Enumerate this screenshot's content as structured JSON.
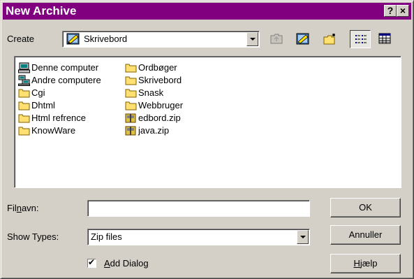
{
  "window": {
    "title": "New Archive",
    "help_glyph": "?",
    "close_glyph": "×"
  },
  "create": {
    "label": "Create",
    "location": "Skrivebord"
  },
  "toolbar": {
    "buttons": [
      "up-folder-icon",
      "desktop-icon",
      "new-folder-icon",
      "list-view-icon",
      "details-view-icon"
    ],
    "active": "list-view-icon"
  },
  "files": {
    "column1": [
      {
        "name": "Denne computer",
        "icon": "computer-icon"
      },
      {
        "name": "Andre computere",
        "icon": "network-icon"
      },
      {
        "name": "Cgi",
        "icon": "folder-icon"
      },
      {
        "name": "Dhtml",
        "icon": "folder-icon"
      },
      {
        "name": "Html refrence",
        "icon": "folder-icon"
      },
      {
        "name": "KnowWare",
        "icon": "folder-icon"
      }
    ],
    "column2": [
      {
        "name": "Ordbøger",
        "icon": "folder-icon"
      },
      {
        "name": "Skrivebord",
        "icon": "folder-icon"
      },
      {
        "name": "Snask",
        "icon": "folder-icon"
      },
      {
        "name": "Webbruger",
        "icon": "folder-icon"
      },
      {
        "name": "edbord.zip",
        "icon": "zip-icon"
      },
      {
        "name": "java.zip",
        "icon": "zip-icon"
      }
    ]
  },
  "filename": {
    "label_pre": "Fil",
    "label_underline": "n",
    "label_post": "avn:",
    "value": ""
  },
  "types": {
    "label": "Show Types:",
    "selected": "Zip files"
  },
  "options": {
    "add_dialog_underline": "A",
    "add_dialog_rest": "dd Dialog",
    "add_dialog_checked": true,
    "check_glyph": "✔"
  },
  "buttons": {
    "ok": "OK",
    "cancel": "Annuller",
    "help_underline": "H",
    "help_rest": "jælp"
  },
  "colors": {
    "titlebar": "#800080",
    "face": "#d4d0c8"
  }
}
